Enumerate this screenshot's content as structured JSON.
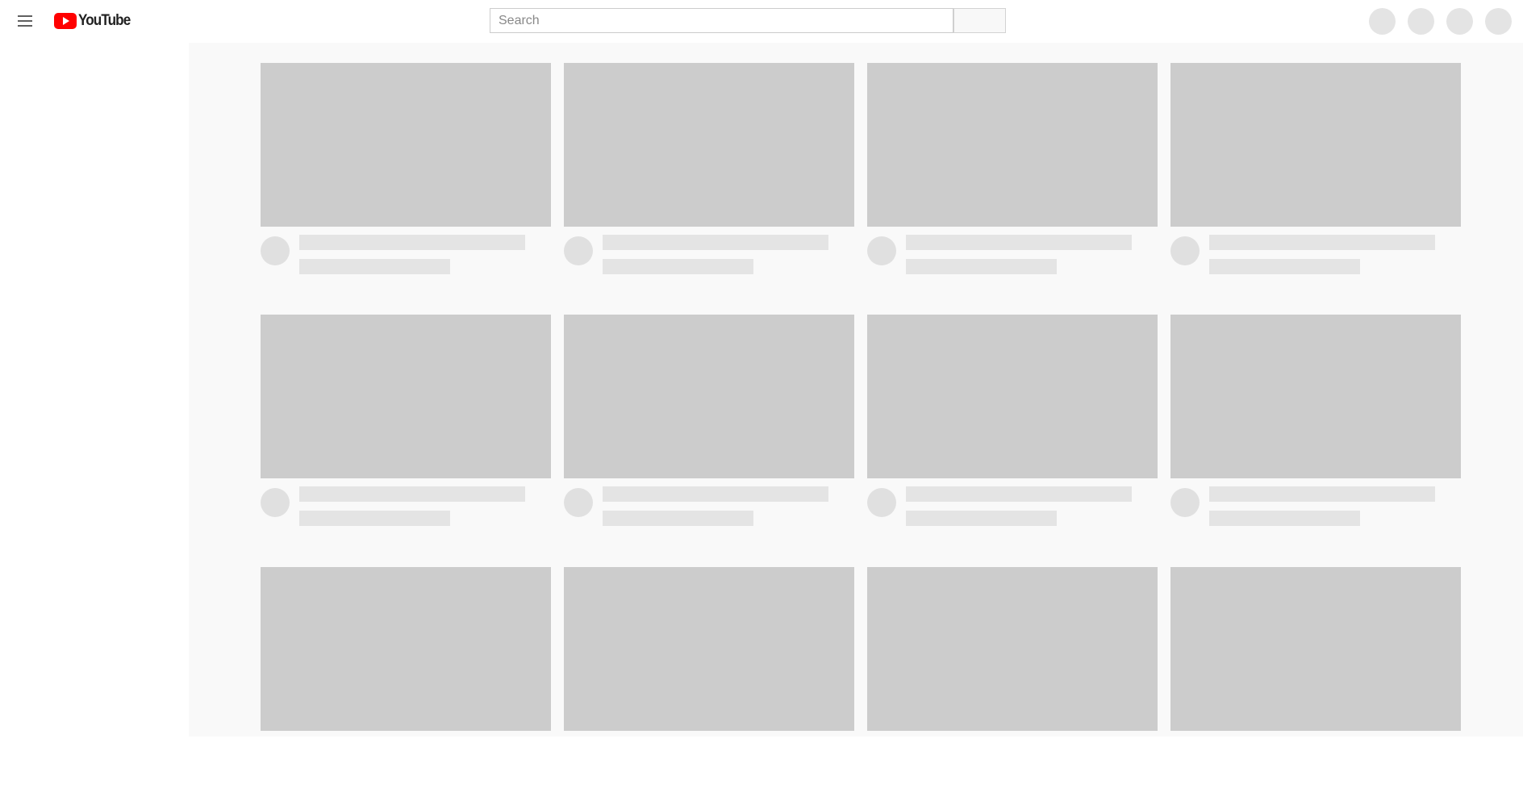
{
  "header": {
    "logo_text": "YouTube",
    "search": {
      "placeholder": "Search",
      "value": ""
    },
    "menu_icon": "hamburger-menu-icon",
    "search_button_icon": "search-icon",
    "action_placeholders": 4
  },
  "colors": {
    "brand_red": "#ff0000",
    "thumbnail_placeholder": "#cccccc",
    "text_placeholder": "#e4e4e4",
    "content_background": "#f9f9f9"
  },
  "state": "loading-skeleton"
}
